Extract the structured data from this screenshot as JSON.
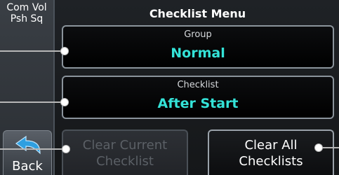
{
  "side_panel": {
    "com_vol": {
      "line1": "Com Vol",
      "line2": "Psh Sq"
    },
    "back": {
      "label": "Back",
      "icon": "back-arrow-icon"
    }
  },
  "menu": {
    "title": "Checklist Menu",
    "group": {
      "label": "Group",
      "value": "Normal"
    },
    "checklist": {
      "label": "Checklist",
      "value": "After Start"
    }
  },
  "actions": {
    "clear_current": {
      "line1": "Clear Current",
      "line2": "Checklist",
      "enabled": false
    },
    "clear_all": {
      "line1": "Clear All",
      "line2": "Checklists",
      "enabled": true
    }
  },
  "colors": {
    "value_text": "#34e3d8",
    "disabled_text": "#5b6066",
    "button_border": "#8b949c",
    "callout": "#b7b7b7"
  }
}
